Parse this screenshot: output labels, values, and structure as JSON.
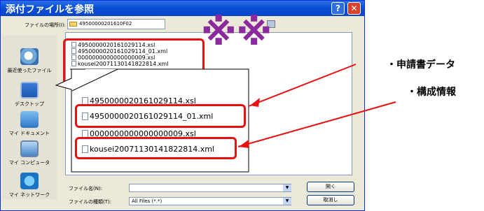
{
  "dialog": {
    "title": "添付ファイルを参照",
    "help_glyph": "?",
    "close_glyph": "✕"
  },
  "toolbar": {
    "lookin_label": "ファイルの場所(I):",
    "lookin_value": "49500000201610F02"
  },
  "places": [
    {
      "label": "最近使ったファイル",
      "icon": "recent-icon"
    },
    {
      "label": "デスクトップ",
      "icon": "desktop-icon"
    },
    {
      "label": "マイ ドキュメント",
      "icon": "my-documents-icon"
    },
    {
      "label": "マイ コンピュータ",
      "icon": "my-computer-icon"
    },
    {
      "label": "マイ ネットワーク",
      "icon": "network-icon"
    }
  ],
  "files": [
    "4950000020161029114.xsl",
    "4950000020161029114_01.xml",
    "0000000000000000009.xsl",
    "kousei20071130141822814.xml"
  ],
  "callout_files": [
    "4950000020161029114.xsl",
    "4950000020161029114_01.xml",
    "0000000000000000009.xsl",
    "kousei20071130141822814.xml"
  ],
  "bottom": {
    "filename_label": "ファイル名(N):",
    "filename_value": "",
    "filetype_label": "ファイルの種類(T):",
    "filetype_value": "All Files (*.*)",
    "open_label": "開く",
    "cancel_label": "取消し"
  },
  "stamp": "※※",
  "annotations": {
    "app_data": "・申請書データ",
    "config_info": "・構成情報"
  },
  "colors": {
    "highlight": "#e81010",
    "stamp": "#8b2a9c",
    "title_bar": "#0a4fd6"
  }
}
